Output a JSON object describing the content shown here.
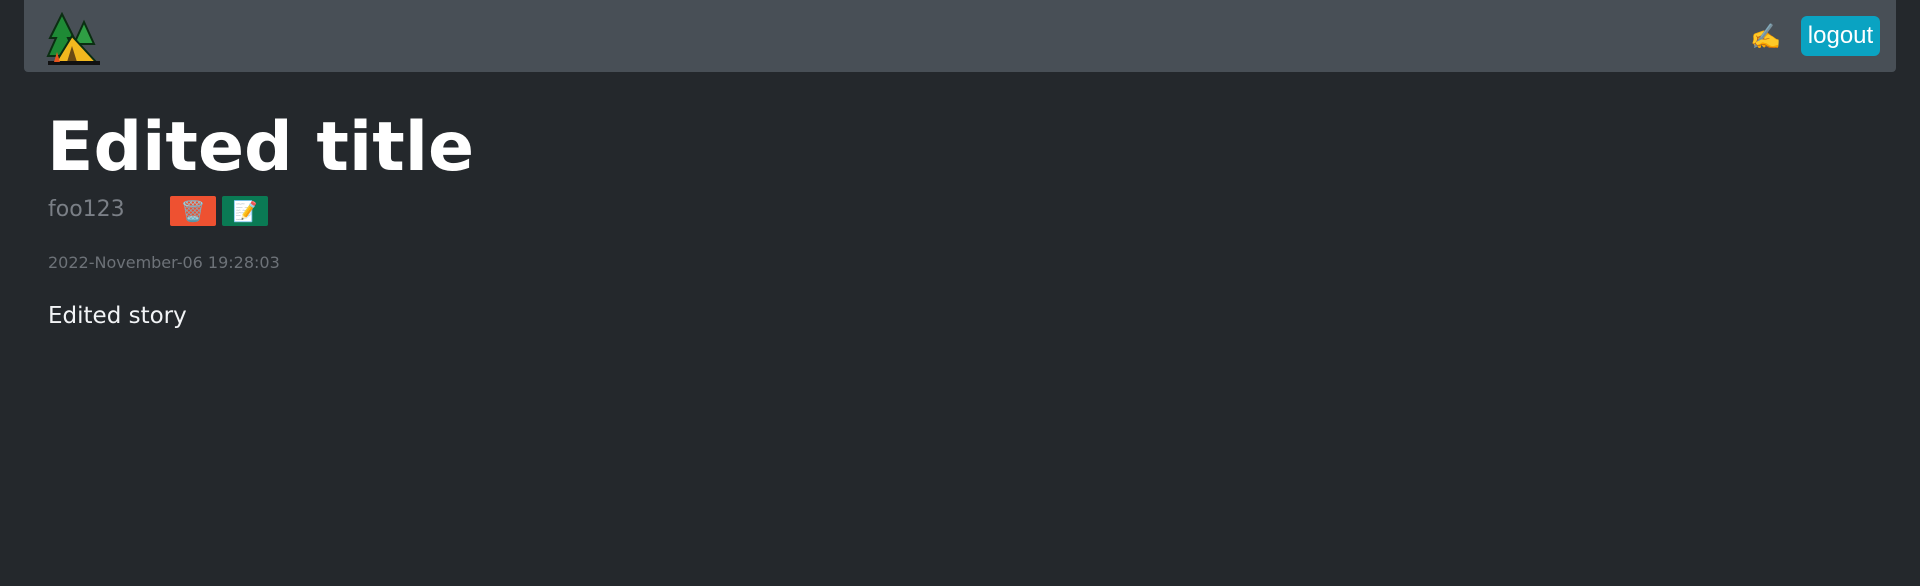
{
  "navbar": {
    "logo_icon": "campsite-icon",
    "new_post_icon": "writing-hand-icon",
    "new_post_glyph": "✍️",
    "logout_label": "logout"
  },
  "post": {
    "title": "Edited title",
    "author": "foo123",
    "delete_icon": "wastebasket-icon",
    "delete_glyph": "🗑️",
    "edit_icon": "memo-icon",
    "edit_glyph": "📝",
    "timestamp": "2022-November-06 19:28:03",
    "body": "Edited story"
  },
  "colors": {
    "background": "#24282c",
    "navbar": "#484f56",
    "logout_button": "#0aa3c2",
    "delete_button": "#ee5131",
    "edit_button": "#0a7a54"
  }
}
